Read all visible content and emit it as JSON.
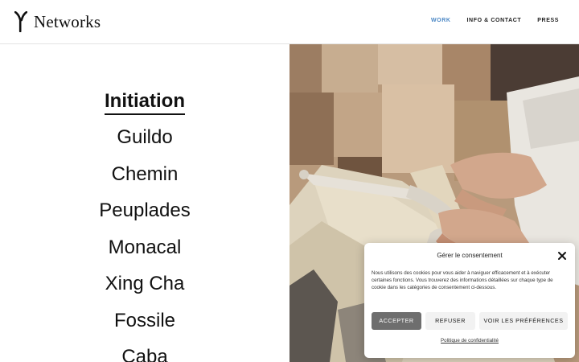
{
  "header": {
    "brand": "Networks",
    "nav": [
      {
        "label": "WORK",
        "active": true
      },
      {
        "label": "INFO & CONTACT",
        "active": false
      },
      {
        "label": "PRESS",
        "active": false
      }
    ]
  },
  "projects": [
    {
      "label": "Initiation",
      "active": true
    },
    {
      "label": "Guildo",
      "active": false
    },
    {
      "label": "Chemin",
      "active": false
    },
    {
      "label": "Peuplades",
      "active": false
    },
    {
      "label": "Monacal",
      "active": false
    },
    {
      "label": "Xing Cha",
      "active": false
    },
    {
      "label": "Fossile",
      "active": false
    },
    {
      "label": "Caba",
      "active": false
    }
  ],
  "cookie_dialog": {
    "title": "Gérer le consentement",
    "text": "Nous utilisons des cookies pour vous aider à naviguer efficacement et à exécuter certaines fonctions. Vous trouverez des informations détaillées sur chaque type de cookie dans les catégories de consentement ci-dessous.",
    "accept_label": "ACCEPTER",
    "refuse_label": "REFUSER",
    "prefs_label": "VOIR LES PRÉFÉRENCES",
    "privacy_link": "Politique de confidentialité"
  },
  "colors": {
    "nav_active": "#4a87c5",
    "accept_button": "#6e6e6e"
  }
}
